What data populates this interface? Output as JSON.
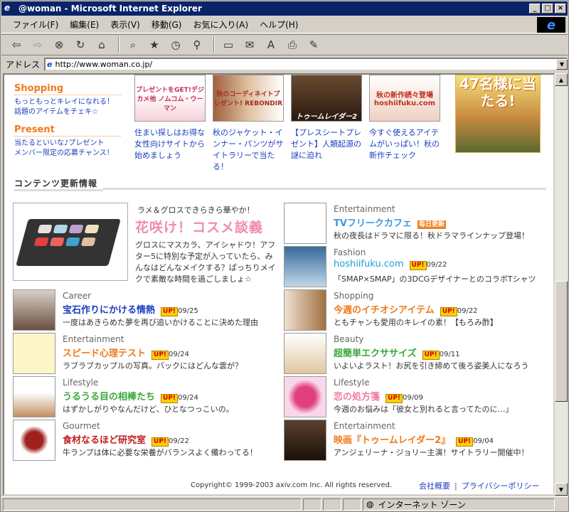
{
  "window": {
    "title": "@woman - Microsoft Internet Explorer"
  },
  "menu": [
    "ファイル(F)",
    "編集(E)",
    "表示(V)",
    "移動(G)",
    "お気に入り(A)",
    "ヘルプ(H)"
  ],
  "address": {
    "label": "アドレス",
    "url": "http://www.woman.co.jp/"
  },
  "left_links": [
    {
      "head": "Shopping",
      "lines": [
        "もっともっとキレイになれる！",
        "話題のアイテムをチェキ☆"
      ]
    },
    {
      "head": "Present",
      "lines": [
        "当たるといいな♪プレゼント",
        "メンバー限定の応募チャンス！"
      ]
    }
  ],
  "promos": [
    {
      "img_text": "プレゼントをGET!デジカメ他 ノムコム・ウーマン",
      "text": "住まい探しはお得な女性向けサイトから始めましょう"
    },
    {
      "img_text": "秋のコーディネイトプレゼント! REBONDIR",
      "text": "秋のジャケット・インナー・パンツがサイトラリーで当たる！"
    },
    {
      "img_text": "トゥームレイダー2",
      "text": "【プレスシートプレゼント】人類起源の謎に迫れ"
    },
    {
      "img_text": "秋の新作続々登場 hoshiifuku.com",
      "text": "今すぐ使えるアイテムがいっぱい！秋の新作チェック"
    }
  ],
  "big_ad": {
    "text": "47名様に当たる!"
  },
  "section": {
    "label": "コンテンツ更新情報"
  },
  "feature": {
    "sub": "ラメ＆グロスできらきら華やか！",
    "headline": "花咲け！コスメ談義",
    "desc": "グロスにマスカラ、アイシャドウ！アフター5に特別な予定が入っていたら、みんなはどんなメイクする？ぱっちりメイクで素敵な時間を過ごしましょ☆"
  },
  "left_items": [
    {
      "cat": "Career",
      "title": "宝石作りにかける情熱",
      "color": "#1a3ebf",
      "badge": "UP!",
      "date": "09/25",
      "desc": "一度はあきらめた夢を再び追いかけることに決めた理由"
    },
    {
      "cat": "Entertainment",
      "title": "スピード心理テスト",
      "color": "#f07a1a",
      "badge": "UP!",
      "date": "09/24",
      "desc": "ラブラブカップルの写真。バックにはどんな雲が？"
    },
    {
      "cat": "Lifestyle",
      "title": "うるうる目の相棒たち",
      "color": "#3aa83a",
      "badge": "UP!",
      "date": "09/24",
      "desc": "はずかしがりやなんだけど、ひとなつっこいの。"
    },
    {
      "cat": "Gourmet",
      "title": "食材なるほど研究室",
      "color": "#c02020",
      "badge": "UP!",
      "date": "09/22",
      "desc": "牛ランプは体に必要な栄養がバランスよく備わってる！"
    }
  ],
  "right_items": [
    {
      "cat": "Entertainment",
      "title": "TVフリークカフェ",
      "color": "#3a9ae0",
      "badge": "毎日更新",
      "date": "",
      "desc": "秋の夜長はドラマに限る！秋ドラマラインナップ登場！"
    },
    {
      "cat": "Fashion",
      "title": "hoshiifuku.com",
      "color": "#1aa0d8",
      "badge": "UP!",
      "date": "09/22",
      "desc": "「SMAP×SMAP」の3DCGデザイナーとのコラボTシャツ"
    },
    {
      "cat": "Shopping",
      "title": "今週のイチオシアイテム",
      "color": "#f07a1a",
      "badge": "UP!",
      "date": "09/22",
      "desc": "ともチャンも愛用のキレイの素！【もろみ酢】"
    },
    {
      "cat": "Beauty",
      "title": "超簡単エクササイズ",
      "color": "#3aa83a",
      "badge": "UP!",
      "date": "09/11",
      "desc": "いよいよラスト！お尻を引き締めて後ろ姿美人になろう"
    },
    {
      "cat": "Lifestyle",
      "title": "恋の処方箋",
      "color": "#f07aa0",
      "badge": "UP!",
      "date": "09/09",
      "desc": "今週のお悩みは「彼女と別れると言ってたのに…」"
    },
    {
      "cat": "Entertainment",
      "title": "映画『トゥームレイダー2』",
      "color": "#f07a1a",
      "badge": "UP!",
      "date": "09/04",
      "desc": "アンジェリーナ・ジョリー主演！サイトラリー開催中！"
    }
  ],
  "footer": {
    "copyright": "Copyright© 1999-2003 axiv.com Inc. All rights reserved.",
    "link1": "会社概要",
    "link2": "プライバシーポリシー"
  },
  "status": {
    "zone": "インターネット ゾーン"
  }
}
